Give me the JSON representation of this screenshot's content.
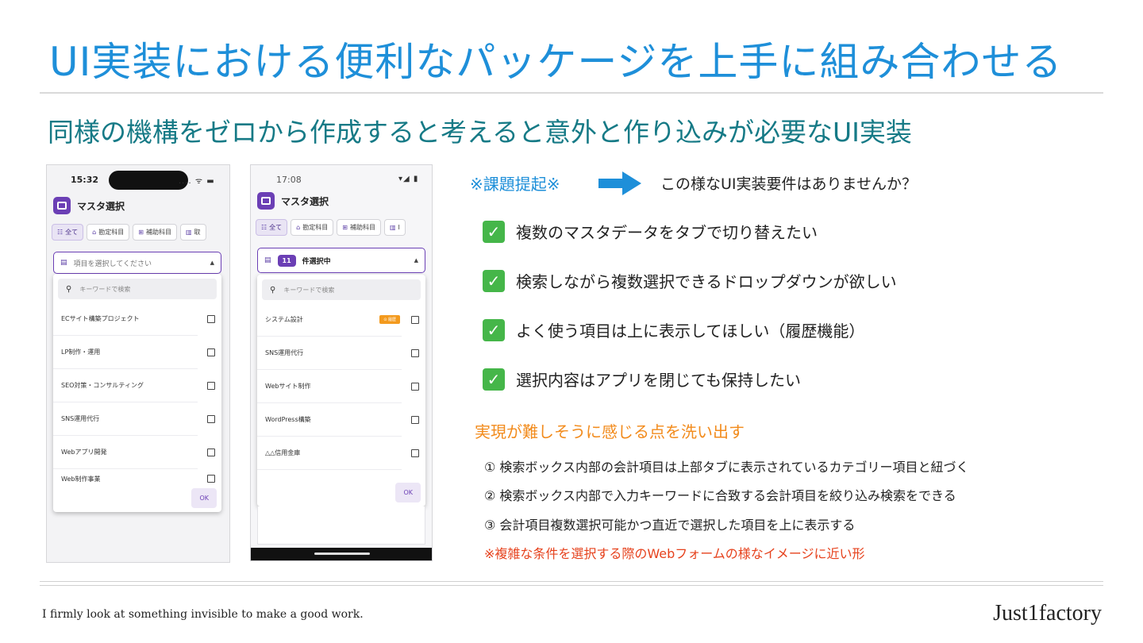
{
  "slide": {
    "title": "UI実装における便利なパッケージを上手に組み合わせる",
    "subtitle": "同様の機構をゼロから作成すると考えると意外と作り込みが必要なUI実装",
    "issue_label": "※課題提起※",
    "question": "この様なUI実装要件はありませんか？",
    "requirements": [
      "複数のマスタデータをタブで切り替えたい",
      "検索しながら複数選択できるドロップダウンが欲しい",
      "よく使う項目は上に表示してほしい（履歴機能）",
      "選択内容はアプリを閉じても保持したい"
    ],
    "difficult_heading": "実現が難しそうに感じる点を洗い出す",
    "points": [
      "① 検索ボックス内部の会計項目は上部タブに表示されているカテゴリー項目と紐づく",
      "② 検索ボックス内部で入力キーワードに合致する会計項目を絞り込み検索をできる",
      "③ 会計項目複数選択可能かつ直近で選択した項目を上に表示する"
    ],
    "note": "※複雑な条件を選択する際のWebフォームの様なイメージに近い形",
    "motto": "I firmly look at something invisible to make a good work.",
    "brand": "Just1factory",
    "colors": {
      "title": "#1e8fd9",
      "subtitle": "#167a86",
      "orange": "#f28b1c",
      "red": "#e6421d",
      "check": "#45b649",
      "accent": "#6b3fb5"
    }
  },
  "phone1": {
    "time": "15:32",
    "status_icons": ".... ᯤ ▬",
    "app_title": "マスタ選択",
    "tabs": [
      "全て",
      "勘定科目",
      "補助科目",
      "取"
    ],
    "placeholder": "項目を選択してください",
    "search_placeholder": "キーワードで検索",
    "items": [
      "ECサイト構築プロジェクト",
      "LP制作・運用",
      "SEO対策・コンサルティング",
      "SNS運用代行",
      "Webアプリ開発",
      "Web制作事業"
    ],
    "ok": "OK"
  },
  "phone2": {
    "time": "17:08",
    "status_icons": "▾◢ ▮",
    "app_title": "マスタ選択",
    "tabs": [
      "全て",
      "勘定科目",
      "補助科目",
      "I"
    ],
    "selected_count": "11",
    "selected_label": "件選択中",
    "search_placeholder": "キーワードで検索",
    "history_badge": "⊙ 履歴",
    "items": [
      "システム設計",
      "SNS運用代行",
      "Webサイト制作",
      "WordPress構築",
      "△△信用金庫"
    ],
    "ok": "OK"
  }
}
